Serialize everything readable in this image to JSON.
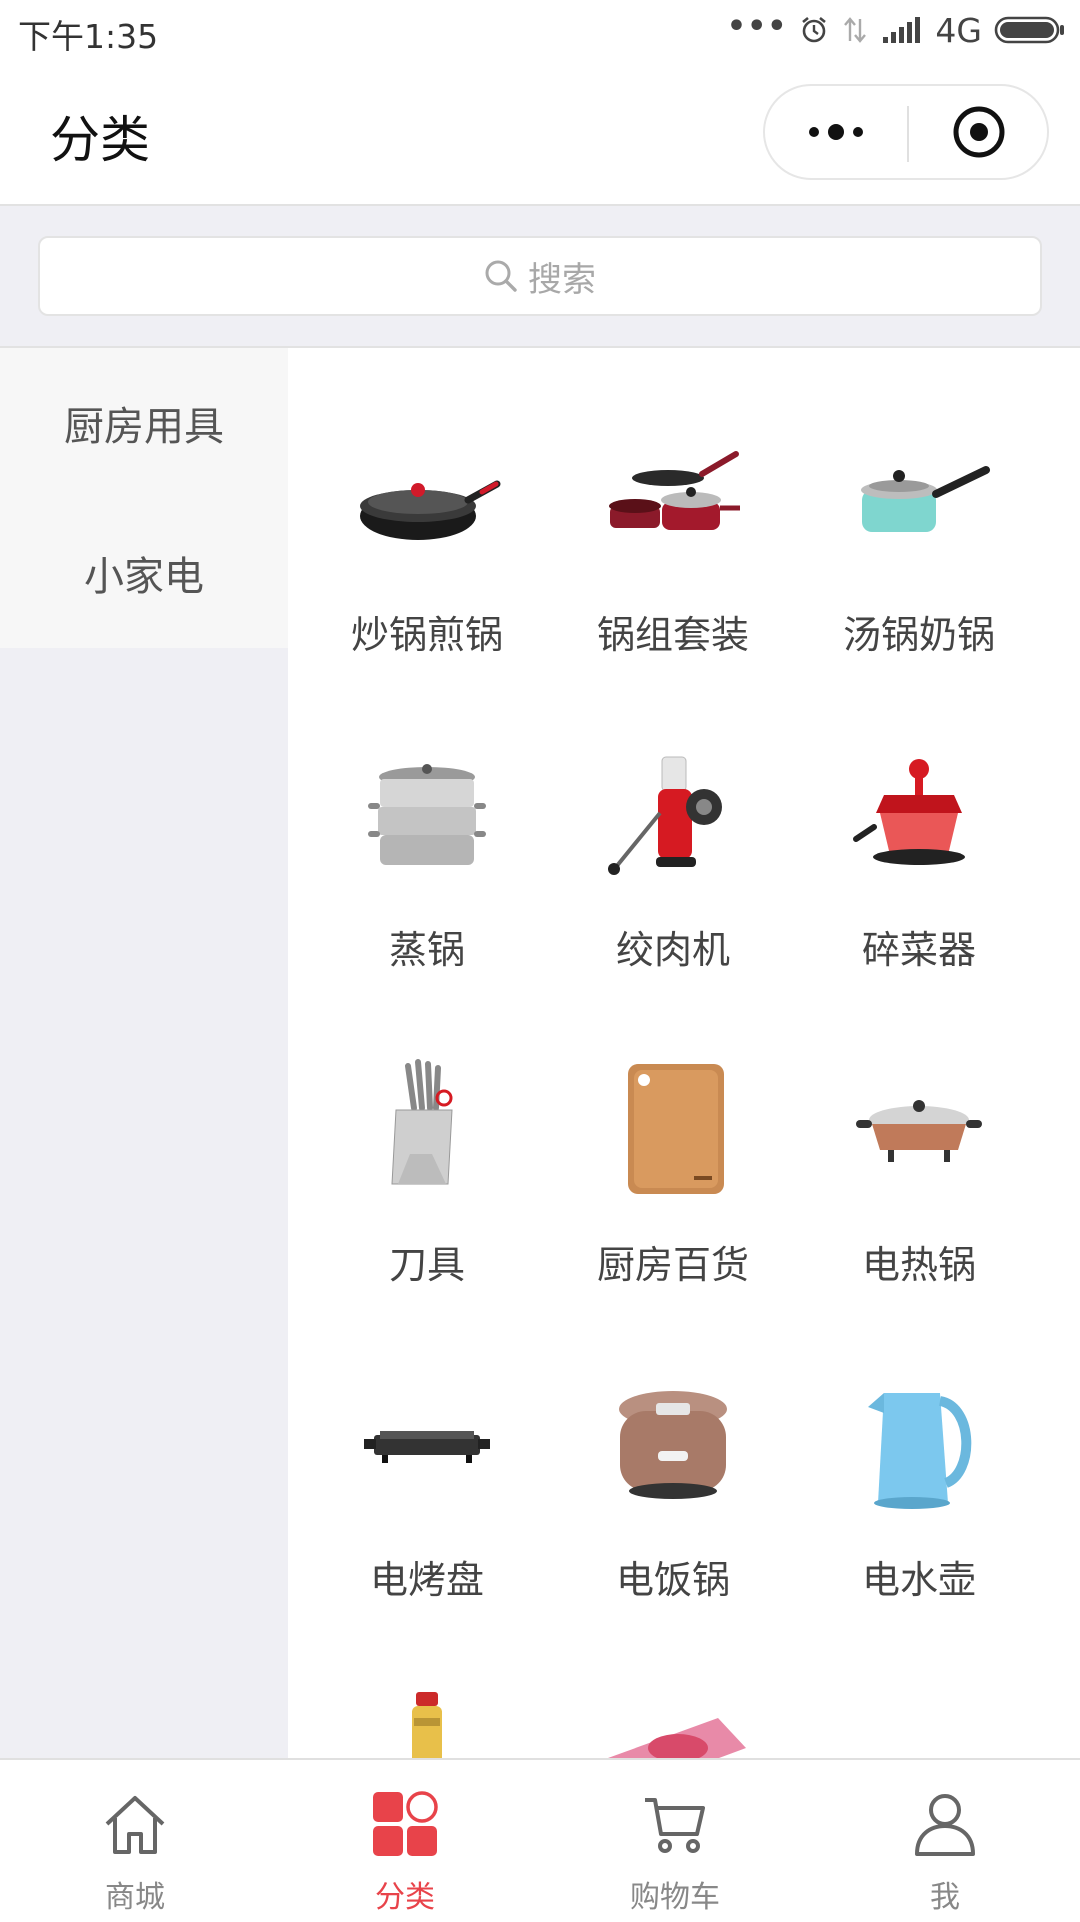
{
  "status_bar": {
    "time": "下午1:35",
    "dots": "•••",
    "network": "4G",
    "icons": [
      "alarm-icon",
      "data-arrows-icon",
      "signal-icon",
      "battery-icon"
    ]
  },
  "nav": {
    "title": "分类",
    "capsule_icons": [
      "more-icon",
      "close-target-icon"
    ]
  },
  "search": {
    "placeholder": "搜索",
    "icon": "search-icon"
  },
  "sidebar": {
    "items": [
      {
        "label": "厨房用具",
        "selected": true
      },
      {
        "label": "小家电",
        "selected": false
      }
    ]
  },
  "grid": {
    "items": [
      {
        "label": "炒锅煎锅",
        "icon": "wok-icon"
      },
      {
        "label": "锅组套装",
        "icon": "pot-set-icon"
      },
      {
        "label": "汤锅奶锅",
        "icon": "milk-pot-icon"
      },
      {
        "label": "蒸锅",
        "icon": "steamer-icon"
      },
      {
        "label": "绞肉机",
        "icon": "meat-grinder-icon"
      },
      {
        "label": "碎菜器",
        "icon": "vegetable-chopper-icon"
      },
      {
        "label": "刀具",
        "icon": "knife-block-icon"
      },
      {
        "label": "厨房百货",
        "icon": "cutting-board-icon"
      },
      {
        "label": "电热锅",
        "icon": "electric-hotpot-icon"
      },
      {
        "label": "电烤盘",
        "icon": "grill-plate-icon"
      },
      {
        "label": "电饭锅",
        "icon": "rice-cooker-icon"
      },
      {
        "label": "电水壶",
        "icon": "kettle-icon"
      },
      {
        "label": "",
        "icon": "bottle-icon"
      },
      {
        "label": "",
        "icon": "induction-cooker-icon"
      }
    ]
  },
  "tabbar": {
    "active_color": "#e8434a",
    "tabs": [
      {
        "label": "商城",
        "icon": "home-icon",
        "active": false
      },
      {
        "label": "分类",
        "icon": "category-icon",
        "active": true
      },
      {
        "label": "购物车",
        "icon": "cart-icon",
        "active": false
      },
      {
        "label": "我",
        "icon": "profile-icon",
        "active": false
      }
    ]
  }
}
